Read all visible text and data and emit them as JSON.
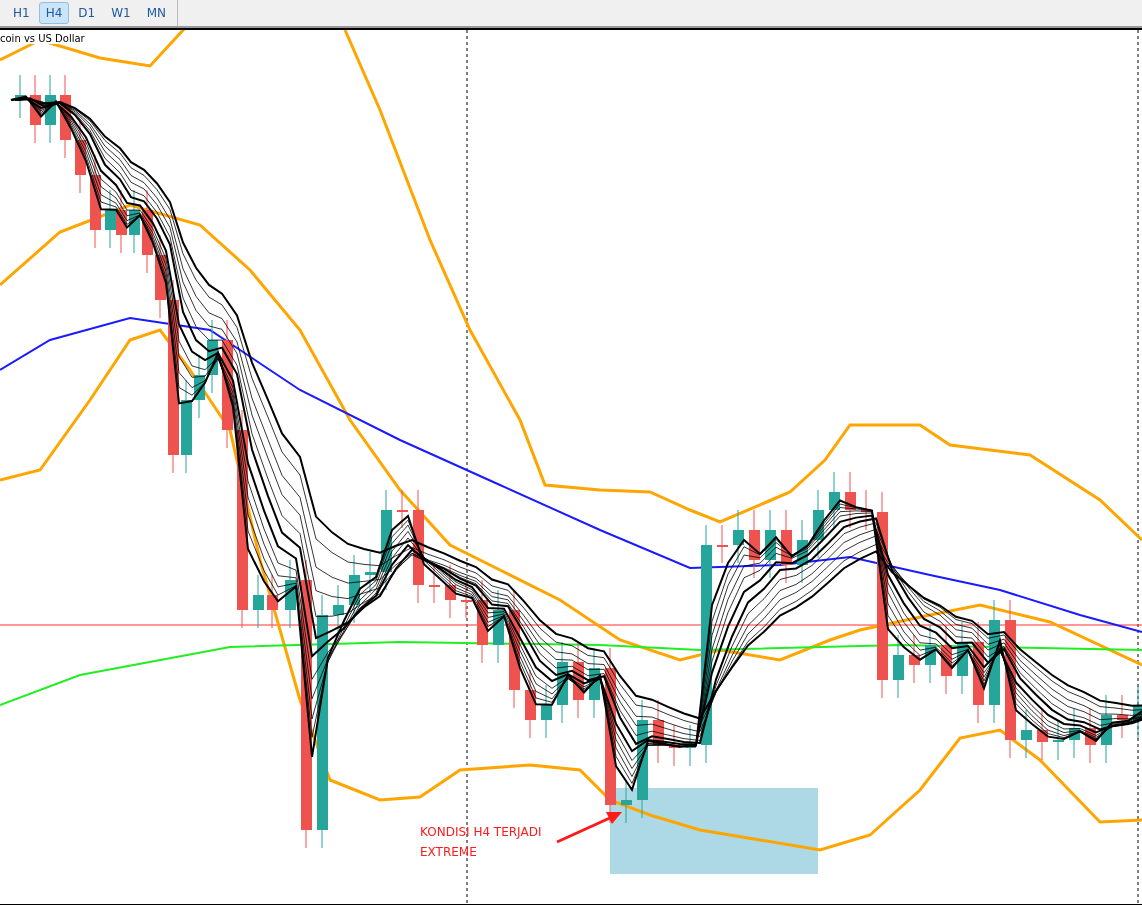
{
  "toolbar": {
    "timeframes": [
      {
        "label": "H1",
        "selected": false
      },
      {
        "label": "H4",
        "selected": true
      },
      {
        "label": "D1",
        "selected": false
      },
      {
        "label": "W1",
        "selected": false
      },
      {
        "label": "MN",
        "selected": false
      }
    ]
  },
  "chart": {
    "title": "coin vs US Dollar",
    "annotation": [
      "KONDISI H4 TERJADI",
      "EXTREME"
    ]
  }
}
